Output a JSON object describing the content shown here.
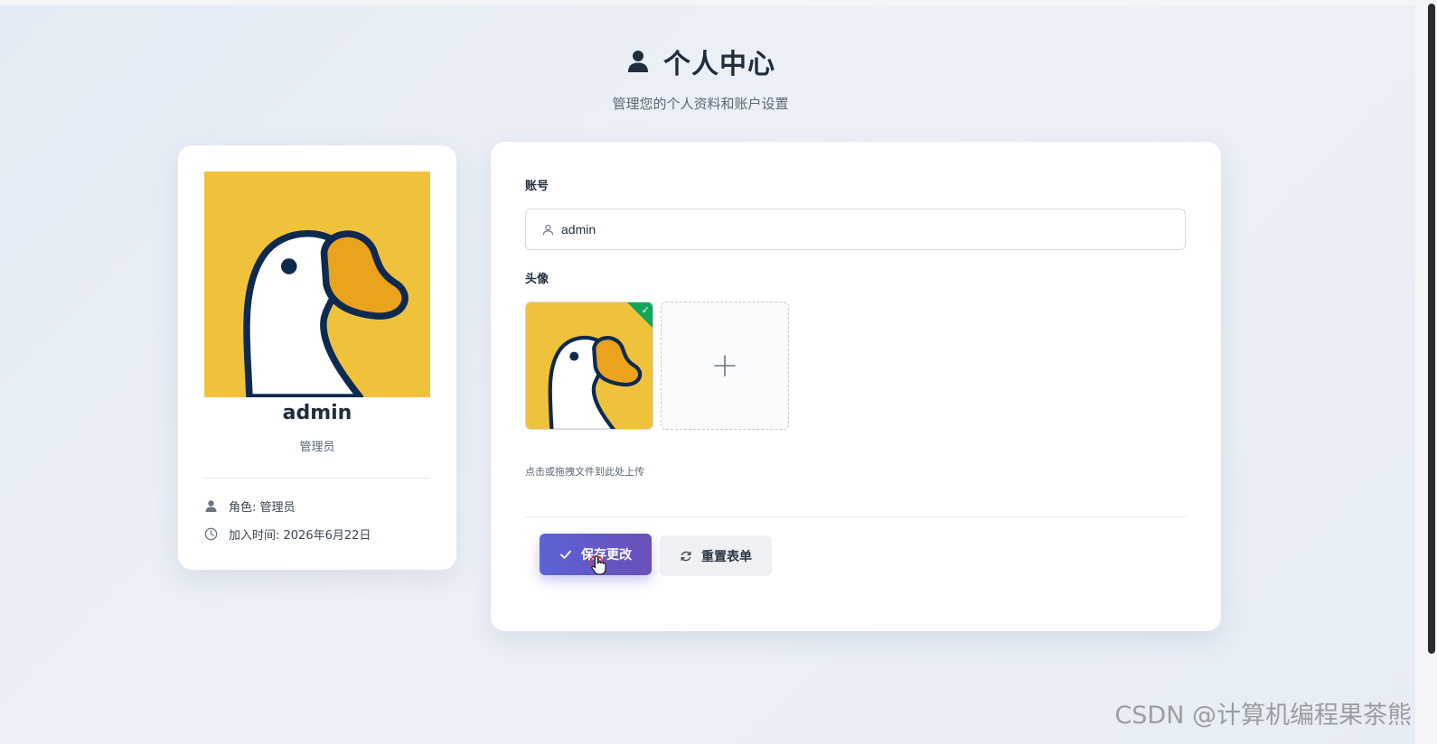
{
  "header": {
    "title": "个人中心",
    "subtitle": "管理您的个人资料和账户设置",
    "title_icon": "user-icon"
  },
  "profile": {
    "name": "admin",
    "role": "管理员",
    "role_line": "角色: 管理员",
    "join_line": "加入时间: 2026年6月22日",
    "avatar": "duck-avatar",
    "role_icon": "user-icon",
    "join_icon": "clock-icon"
  },
  "form": {
    "account_label": "账号",
    "account_value": "admin",
    "avatar_label": "头像",
    "upload_hint": "点击或拖拽文件到此处上传",
    "save_label": "保存更改",
    "reset_label": "重置表单"
  },
  "colors": {
    "primary_start": "#5b63d6",
    "primary_end": "#6a4fb8",
    "success": "#13a65b",
    "avatar_bg": "#f0c23c",
    "beak": "#eba21c",
    "outline": "#0f2a4f"
  },
  "watermark": "CSDN @计算机编程果茶熊"
}
